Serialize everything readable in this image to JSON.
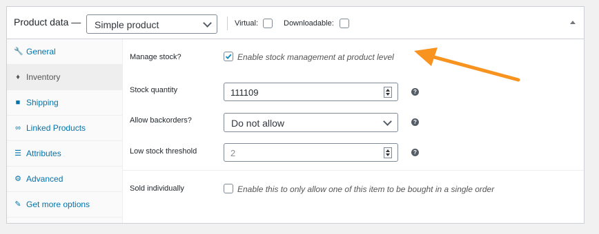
{
  "header": {
    "title": "Product data —",
    "product_type": "Simple product",
    "virtual_label": "Virtual:",
    "downloadable_label": "Downloadable:"
  },
  "sidebar": {
    "items": [
      {
        "label": "General",
        "icon": "wrench-icon"
      },
      {
        "label": "Inventory",
        "icon": "tag-icon"
      },
      {
        "label": "Shipping",
        "icon": "truck-icon"
      },
      {
        "label": "Linked Products",
        "icon": "link-icon"
      },
      {
        "label": "Attributes",
        "icon": "list-icon"
      },
      {
        "label": "Advanced",
        "icon": "gear-icon"
      },
      {
        "label": "Get more options",
        "icon": "plugin-icon"
      }
    ],
    "active": "Inventory"
  },
  "inventory": {
    "manage_stock": {
      "label": "Manage stock?",
      "checked": true,
      "description": "Enable stock management at product level"
    },
    "stock_quantity": {
      "label": "Stock quantity",
      "value": "111109"
    },
    "backorders": {
      "label": "Allow backorders?",
      "value": "Do not allow"
    },
    "low_stock": {
      "label": "Low stock threshold",
      "placeholder": "2"
    },
    "sold_individually": {
      "label": "Sold individually",
      "checked": false,
      "description": "Enable this to only allow one of this item to be bought in a single order"
    }
  },
  "colors": {
    "accent": "#0073aa",
    "arrow": "#f7931e",
    "checkmark": "#1e8cbe"
  }
}
